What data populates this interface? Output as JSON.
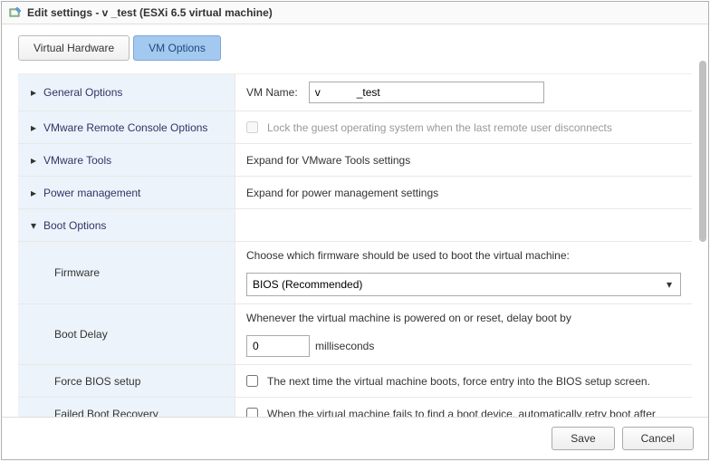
{
  "titlebar": {
    "title": "Edit settings - v          _test (ESXi 6.5 virtual machine)"
  },
  "tabs": {
    "hardware": "Virtual Hardware",
    "vm_options": "VM Options"
  },
  "sections": {
    "general_options": {
      "label": "General Options",
      "vm_name_label": "VM Name:",
      "vm_name_value": "v            _test"
    },
    "remote_console": {
      "label": "VMware Remote Console Options",
      "lock_text": "Lock the guest operating system when the last remote user disconnects"
    },
    "vmware_tools": {
      "label": "VMware Tools",
      "text": "Expand for VMware Tools settings"
    },
    "power_management": {
      "label": "Power management",
      "text": "Expand for power management settings"
    },
    "boot_options": {
      "label": "Boot Options",
      "firmware": {
        "label": "Firmware",
        "desc": "Choose which firmware should be used to boot the virtual machine:",
        "selected": "BIOS (Recommended)"
      },
      "boot_delay": {
        "label": "Boot Delay",
        "desc": "Whenever the virtual machine is powered on or reset, delay boot by",
        "value": "0",
        "unit": "milliseconds"
      },
      "force_bios": {
        "label": "Force BIOS setup",
        "text": "The next time the virtual machine boots, force entry into the BIOS setup screen."
      },
      "failed_recovery": {
        "label": "Failed Boot Recovery",
        "text": "When the virtual machine fails to find a boot device, automatically retry boot after"
      }
    }
  },
  "buttons": {
    "save": "Save",
    "cancel": "Cancel"
  }
}
